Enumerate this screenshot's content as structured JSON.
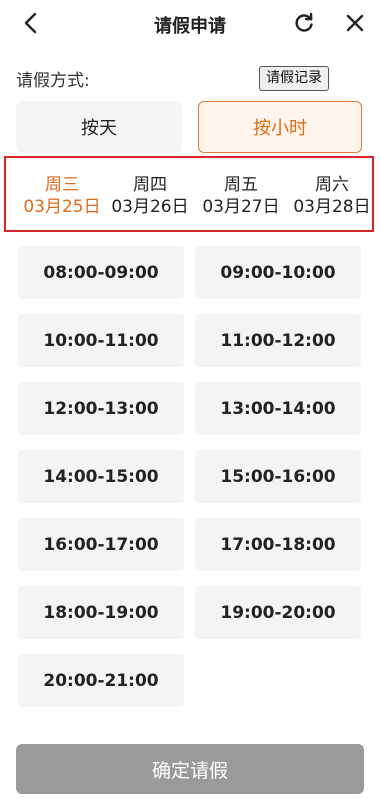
{
  "header": {
    "title": "请假申请",
    "icons": {
      "back": "chevron-left-icon",
      "refresh": "refresh-icon",
      "close": "close-icon"
    }
  },
  "leave_method": {
    "label": "请假方式:",
    "records_button": "请假记录",
    "options": [
      {
        "label": "按天",
        "selected": false
      },
      {
        "label": "按小时",
        "selected": true
      }
    ]
  },
  "dates": [
    {
      "weekday": "周三",
      "date": "03月25日",
      "selected": true
    },
    {
      "weekday": "周四",
      "date": "03月26日",
      "selected": false
    },
    {
      "weekday": "周五",
      "date": "03月27日",
      "selected": false
    },
    {
      "weekday": "周六",
      "date": "03月28日",
      "selected": false
    }
  ],
  "time_slots": [
    "08:00-09:00",
    "09:00-10:00",
    "10:00-11:00",
    "11:00-12:00",
    "12:00-13:00",
    "13:00-14:00",
    "14:00-15:00",
    "15:00-16:00",
    "16:00-17:00",
    "17:00-18:00",
    "18:00-19:00",
    "19:00-20:00",
    "20:00-21:00"
  ],
  "confirm_button": "确定请假",
  "colors": {
    "accent": "#e06a18",
    "highlight_border": "#d9262b",
    "tile_background": "#f4f4f4",
    "confirm_disabled": "#9a9a9a"
  }
}
